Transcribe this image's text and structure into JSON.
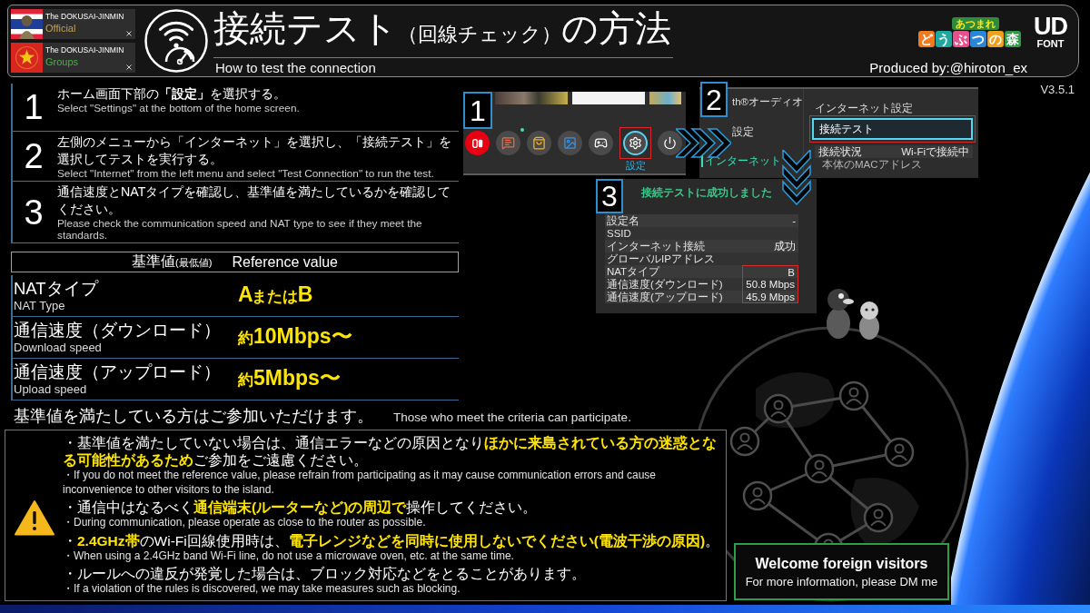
{
  "header": {
    "accounts": [
      {
        "name": "The DOKUSAI-JINMIN",
        "group": "Official",
        "color": "#c9a13f",
        "kind": "stripes"
      },
      {
        "name": "The DOKUSAI-JINMIN",
        "group": "Groups",
        "color": "#3db83d",
        "kind": "star"
      }
    ],
    "title": [
      {
        "text": "接続テスト",
        "small": false
      },
      {
        "text": "（回線チェック）",
        "small": true
      },
      {
        "text": "の方法",
        "small": false
      }
    ],
    "subtitle": "How to test the connection",
    "game_logo": {
      "top": "あつまれ",
      "bottom": "どうぶつの森"
    },
    "font_logo": {
      "top": "UD",
      "bottom": "FONT"
    },
    "credit": "Produced by:@hiroton_ex"
  },
  "version": "V3.5.1",
  "steps": [
    {
      "number": "1",
      "text": "ホーム画面下部の**「設定」**を選択する。",
      "translation": "Select \"Settings\" at the bottom of the home screen."
    },
    {
      "number": "2",
      "text": "左側のメニューから「インターネット」を選択し、「接続テスト」を選択してテストを実行する。",
      "translation": "Select \"Internet\" from the left menu and select \"Test Connection\" to run the test."
    },
    {
      "number": "3",
      "text": "通信速度とNATタイプを確認し、基準値を満たしているかを確認してください。",
      "translation": "Please check the communication speed and NAT type to see if they meet the standards."
    }
  ],
  "reference": {
    "heading": [
      {
        "text": "基準値",
        "small": false
      },
      {
        "text": "(最低値)",
        "small": true
      }
    ],
    "heading_en": "Reference value",
    "rows": [
      {
        "label": "NATタイプ",
        "label_en": "NAT Type",
        "value": [
          {
            "text": "A",
            "small": false
          },
          {
            "text": "または",
            "small": true
          },
          {
            "text": "B",
            "small": false
          }
        ]
      },
      {
        "label": "通信速度（ダウンロード）",
        "label_en": "Download speed",
        "value": [
          {
            "text": "約",
            "small": true
          },
          {
            "text": "10Mbps〜",
            "small": false
          }
        ]
      },
      {
        "label": "通信速度（アップロード）",
        "label_en": "Upload speed",
        "value": [
          {
            "text": "約",
            "small": true
          },
          {
            "text": "5Mbps〜",
            "small": false
          }
        ]
      }
    ]
  },
  "eligibility": {
    "text": "基準値を満たしている方はご参加いただけます。",
    "translation": "Those who meet the criteria can participate."
  },
  "screens": [
    {
      "kind": "home",
      "badge": "1",
      "icons": [
        {
          "kind": "online",
          "selected": false,
          "notification": false
        },
        {
          "kind": "news",
          "selected": false,
          "notification": true
        },
        {
          "kind": "shop",
          "selected": false,
          "notification": false
        },
        {
          "kind": "album",
          "selected": false,
          "notification": false
        },
        {
          "kind": "controller",
          "selected": false,
          "notification": false
        },
        {
          "kind": "settings",
          "selected": true,
          "notification": false,
          "label": "設定"
        },
        {
          "kind": "power",
          "selected": false,
          "notification": false
        }
      ]
    },
    {
      "kind": "settings",
      "badge": "2",
      "menu": [
        {
          "label": "th®オーディオ",
          "selected": false
        },
        {
          "label": "設定",
          "selected": false
        },
        {
          "label": "インターネット",
          "selected": true
        }
      ],
      "heading": "インターネット設定",
      "action": {
        "label": "接続テスト",
        "selected": true
      },
      "status": {
        "label": "接続状況",
        "value": "Wi-Fiで接続中"
      },
      "detail": "本体のMACアドレス"
    },
    {
      "kind": "result",
      "badge": "3",
      "title": "接続テストに成功しました",
      "rows": [
        {
          "label": "設定名",
          "value": "-",
          "highlighted": false
        },
        {
          "label": "SSID",
          "highlighted": false
        },
        {
          "label": "インターネット接続",
          "value": "成功",
          "highlighted": false
        },
        {
          "label": "グローバルIPアドレス",
          "highlighted": false
        },
        {
          "label": "NATタイプ",
          "value": "B",
          "highlighted": true
        },
        {
          "label": "通信速度(ダウンロード)",
          "value": "50.8 Mbps",
          "highlighted": true
        },
        {
          "label": "通信速度(アップロード)",
          "value": "45.9 Mbps",
          "highlighted": true
        }
      ]
    }
  ],
  "notices": [
    {
      "text": "・基準値を満たしていない場合は、通信エラーなどの原因となり**ほかに来島されている方の迷惑となる可能性があるため**ご参加をご遠慮ください。",
      "translation": "・If you do not meet the reference value, please refrain from participating as it may cause communication errors and cause inconvenience to other visitors to the island."
    },
    {
      "text": "・通信中はなるべく**通信端末(ルーターなど)の周辺で**操作してください。",
      "translation": "・During communication, please operate as close to the router as possible."
    },
    {
      "text": "・**2.4GHz帯**のWi-Fi回線使用時は、**電子レンジなどを同時に使用しないでください(電波干渉の原因)**。",
      "translation": "・When using a 2.4GHz band Wi-Fi line, do not use a microwave oven, etc. at the same time."
    },
    {
      "text": "・ルールへの違反が発覚した場合は、ブロック対応などをとることがあります。",
      "translation": "・If a violation of the rules is discovered, we may take measures such as blocking."
    }
  ],
  "welcome": {
    "title": "Welcome foreign visitors",
    "text": "For more information, please DM me"
  }
}
